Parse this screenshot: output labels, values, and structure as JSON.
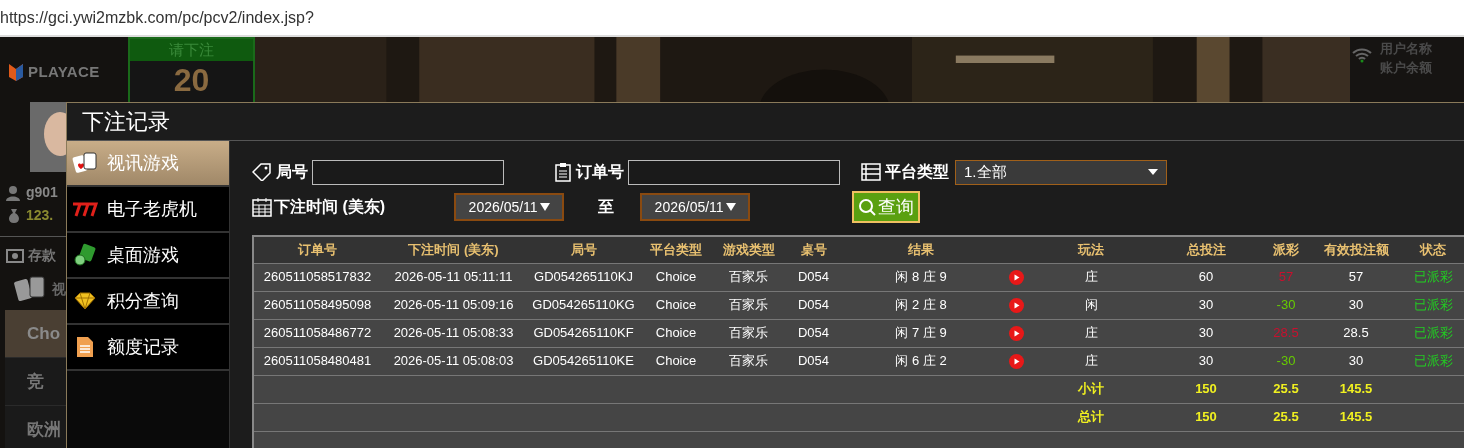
{
  "browser": {
    "url": "https://gci.ywi2mzbk.com/pc/pcv2/index.jsp?"
  },
  "game": {
    "logo": "PLAYACE",
    "countdown": {
      "label": "请下注",
      "value": "20"
    },
    "player": {
      "username": "g901",
      "balance": "123."
    },
    "deposit": "存款",
    "game_tab": "视",
    "nav": [
      {
        "label": "Cho",
        "selected": true
      },
      {
        "label": "竞",
        "selected": false
      },
      {
        "label": "欧洲",
        "selected": false
      }
    ],
    "table_info": [
      "用户名称",
      "账户余额"
    ]
  },
  "dialog": {
    "title": "下注记录",
    "categories": [
      {
        "label": "视讯游戏",
        "kind": "cards",
        "selected": true
      },
      {
        "label": "电子老虎机",
        "kind": "slots",
        "selected": false
      },
      {
        "label": "桌面游戏",
        "kind": "table",
        "selected": false
      },
      {
        "label": "积分查询",
        "kind": "points",
        "selected": false
      },
      {
        "label": "额度记录",
        "kind": "credit",
        "selected": false
      }
    ],
    "filters": {
      "round_label": "局号",
      "order_label": "订单号",
      "platform_label": "平台类型",
      "platform_value": "1.全部",
      "time_label": "下注时间 (美东)",
      "date_from": "2026/05/11",
      "to_label": "至",
      "date_to": "2026/05/11",
      "search_button": "查询"
    },
    "table": {
      "columns": [
        "订单号",
        "下注时间 (美东)",
        "局号",
        "平台类型",
        "游戏类型",
        "桌号",
        "结果",
        "玩法",
        "总投注",
        "派彩",
        "有效投注额",
        "状态"
      ],
      "rows": [
        {
          "order": "260511058517832",
          "time": "2026-05-11 05:11:11",
          "round": "GD054265110KJ",
          "platform": "Choice",
          "game": "百家乐",
          "table": "D054",
          "result": "闲 8 庄 9",
          "bet_on": "庄",
          "total_bet": "60",
          "payout": {
            "text": "57",
            "color": "#c8102e"
          },
          "valid_bet": "57",
          "status": "已派彩"
        },
        {
          "order": "260511058495098",
          "time": "2026-05-11 05:09:16",
          "round": "GD054265110KG",
          "platform": "Choice",
          "game": "百家乐",
          "table": "D054",
          "result": "闲 2 庄 8",
          "bet_on": "闲",
          "total_bet": "30",
          "payout": {
            "text": "-30",
            "color": "#66cc00"
          },
          "valid_bet": "30",
          "status": "已派彩"
        },
        {
          "order": "260511058486772",
          "time": "2026-05-11 05:08:33",
          "round": "GD054265110KF",
          "platform": "Choice",
          "game": "百家乐",
          "table": "D054",
          "result": "闲 7 庄 9",
          "bet_on": "庄",
          "total_bet": "30",
          "payout": {
            "text": "28.5",
            "color": "#c8102e"
          },
          "valid_bet": "28.5",
          "status": "已派彩"
        },
        {
          "order": "260511058480481",
          "time": "2026-05-11 05:08:03",
          "round": "GD054265110KE",
          "platform": "Choice",
          "game": "百家乐",
          "table": "D054",
          "result": "闲 6 庄 2",
          "bet_on": "庄",
          "total_bet": "30",
          "payout": {
            "text": "-30",
            "color": "#66cc00"
          },
          "valid_bet": "30",
          "status": "已派彩"
        }
      ],
      "summary": [
        {
          "label": "小计",
          "total_bet": "150",
          "payout": "25.5",
          "valid_bet": "145.5"
        },
        {
          "label": "总计",
          "total_bet": "150",
          "payout": "25.5",
          "valid_bet": "145.5"
        }
      ]
    }
  }
}
